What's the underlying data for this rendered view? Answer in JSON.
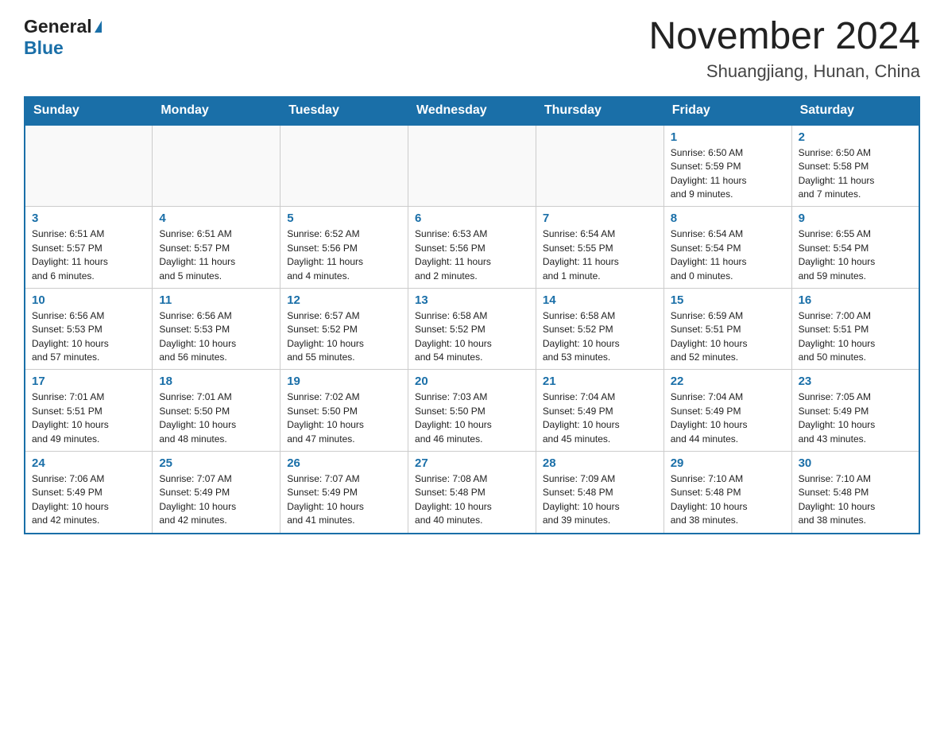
{
  "header": {
    "logo_general": "General",
    "logo_blue": "Blue",
    "title": "November 2024",
    "subtitle": "Shuangjiang, Hunan, China"
  },
  "weekdays": [
    "Sunday",
    "Monday",
    "Tuesday",
    "Wednesday",
    "Thursday",
    "Friday",
    "Saturday"
  ],
  "weeks": [
    {
      "days": [
        {
          "num": "",
          "info": "",
          "empty": true
        },
        {
          "num": "",
          "info": "",
          "empty": true
        },
        {
          "num": "",
          "info": "",
          "empty": true
        },
        {
          "num": "",
          "info": "",
          "empty": true
        },
        {
          "num": "",
          "info": "",
          "empty": true
        },
        {
          "num": "1",
          "info": "Sunrise: 6:50 AM\nSunset: 5:59 PM\nDaylight: 11 hours\nand 9 minutes."
        },
        {
          "num": "2",
          "info": "Sunrise: 6:50 AM\nSunset: 5:58 PM\nDaylight: 11 hours\nand 7 minutes."
        }
      ]
    },
    {
      "days": [
        {
          "num": "3",
          "info": "Sunrise: 6:51 AM\nSunset: 5:57 PM\nDaylight: 11 hours\nand 6 minutes."
        },
        {
          "num": "4",
          "info": "Sunrise: 6:51 AM\nSunset: 5:57 PM\nDaylight: 11 hours\nand 5 minutes."
        },
        {
          "num": "5",
          "info": "Sunrise: 6:52 AM\nSunset: 5:56 PM\nDaylight: 11 hours\nand 4 minutes."
        },
        {
          "num": "6",
          "info": "Sunrise: 6:53 AM\nSunset: 5:56 PM\nDaylight: 11 hours\nand 2 minutes."
        },
        {
          "num": "7",
          "info": "Sunrise: 6:54 AM\nSunset: 5:55 PM\nDaylight: 11 hours\nand 1 minute."
        },
        {
          "num": "8",
          "info": "Sunrise: 6:54 AM\nSunset: 5:54 PM\nDaylight: 11 hours\nand 0 minutes."
        },
        {
          "num": "9",
          "info": "Sunrise: 6:55 AM\nSunset: 5:54 PM\nDaylight: 10 hours\nand 59 minutes."
        }
      ]
    },
    {
      "days": [
        {
          "num": "10",
          "info": "Sunrise: 6:56 AM\nSunset: 5:53 PM\nDaylight: 10 hours\nand 57 minutes."
        },
        {
          "num": "11",
          "info": "Sunrise: 6:56 AM\nSunset: 5:53 PM\nDaylight: 10 hours\nand 56 minutes."
        },
        {
          "num": "12",
          "info": "Sunrise: 6:57 AM\nSunset: 5:52 PM\nDaylight: 10 hours\nand 55 minutes."
        },
        {
          "num": "13",
          "info": "Sunrise: 6:58 AM\nSunset: 5:52 PM\nDaylight: 10 hours\nand 54 minutes."
        },
        {
          "num": "14",
          "info": "Sunrise: 6:58 AM\nSunset: 5:52 PM\nDaylight: 10 hours\nand 53 minutes."
        },
        {
          "num": "15",
          "info": "Sunrise: 6:59 AM\nSunset: 5:51 PM\nDaylight: 10 hours\nand 52 minutes."
        },
        {
          "num": "16",
          "info": "Sunrise: 7:00 AM\nSunset: 5:51 PM\nDaylight: 10 hours\nand 50 minutes."
        }
      ]
    },
    {
      "days": [
        {
          "num": "17",
          "info": "Sunrise: 7:01 AM\nSunset: 5:51 PM\nDaylight: 10 hours\nand 49 minutes."
        },
        {
          "num": "18",
          "info": "Sunrise: 7:01 AM\nSunset: 5:50 PM\nDaylight: 10 hours\nand 48 minutes."
        },
        {
          "num": "19",
          "info": "Sunrise: 7:02 AM\nSunset: 5:50 PM\nDaylight: 10 hours\nand 47 minutes."
        },
        {
          "num": "20",
          "info": "Sunrise: 7:03 AM\nSunset: 5:50 PM\nDaylight: 10 hours\nand 46 minutes."
        },
        {
          "num": "21",
          "info": "Sunrise: 7:04 AM\nSunset: 5:49 PM\nDaylight: 10 hours\nand 45 minutes."
        },
        {
          "num": "22",
          "info": "Sunrise: 7:04 AM\nSunset: 5:49 PM\nDaylight: 10 hours\nand 44 minutes."
        },
        {
          "num": "23",
          "info": "Sunrise: 7:05 AM\nSunset: 5:49 PM\nDaylight: 10 hours\nand 43 minutes."
        }
      ]
    },
    {
      "days": [
        {
          "num": "24",
          "info": "Sunrise: 7:06 AM\nSunset: 5:49 PM\nDaylight: 10 hours\nand 42 minutes."
        },
        {
          "num": "25",
          "info": "Sunrise: 7:07 AM\nSunset: 5:49 PM\nDaylight: 10 hours\nand 42 minutes."
        },
        {
          "num": "26",
          "info": "Sunrise: 7:07 AM\nSunset: 5:49 PM\nDaylight: 10 hours\nand 41 minutes."
        },
        {
          "num": "27",
          "info": "Sunrise: 7:08 AM\nSunset: 5:48 PM\nDaylight: 10 hours\nand 40 minutes."
        },
        {
          "num": "28",
          "info": "Sunrise: 7:09 AM\nSunset: 5:48 PM\nDaylight: 10 hours\nand 39 minutes."
        },
        {
          "num": "29",
          "info": "Sunrise: 7:10 AM\nSunset: 5:48 PM\nDaylight: 10 hours\nand 38 minutes."
        },
        {
          "num": "30",
          "info": "Sunrise: 7:10 AM\nSunset: 5:48 PM\nDaylight: 10 hours\nand 38 minutes."
        }
      ]
    }
  ]
}
